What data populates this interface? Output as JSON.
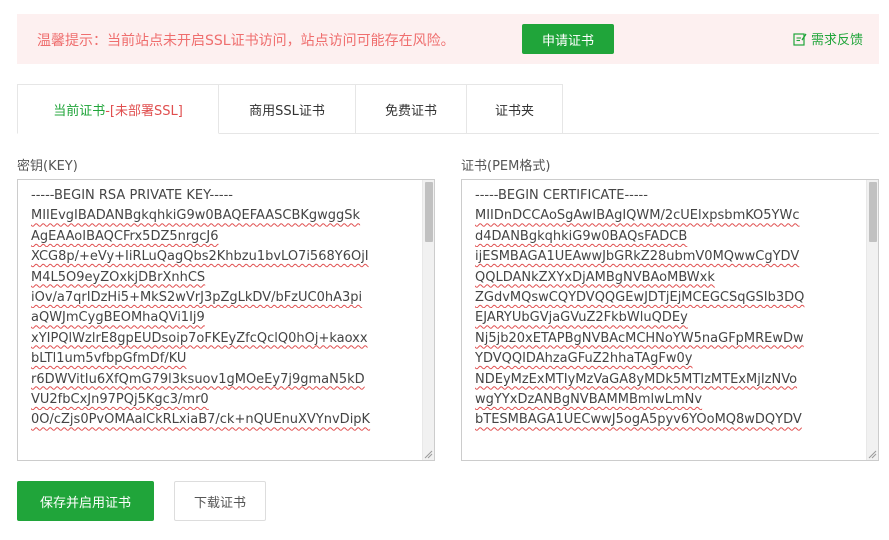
{
  "banner": {
    "warning_text": "温馨提示：当前站点未开启SSL证书访问，站点访问可能存在风险。",
    "apply_label": "申请证书",
    "feedback_label": "需求反馈",
    "feedback_icon": "edit-icon"
  },
  "tabs": [
    {
      "label": "当前证书",
      "status": " -[未部署SSL]",
      "active": true
    },
    {
      "label": "商用SSL证书",
      "active": false
    },
    {
      "label": "免费证书",
      "active": false
    },
    {
      "label": "证书夹",
      "active": false
    }
  ],
  "key_field": {
    "label": "密钥(KEY)",
    "lines": [
      "-----BEGIN RSA PRIVATE KEY-----",
      "MIIEvgIBADANBgkqhkiG9w0BAQEFAASCBKgwggSk",
      "AgEAAoIBAQCFrx5DZ5nrgcJ6",
      "XCG8p/+eVy+IiRLuQagQbs2Khbzu1bvLO7i568Y6OjI",
      "M4L5O9eyZOxkjDBrXnhCS",
      "iOv/a7qrIDzHi5+MkS2wVrJ3pZgLkDV/bFzUC0hA3pi",
      "aQWJmCygBEOMhaQVi1Ij9",
      "xYIPQlWzlrE8gpEUDsoip7oFKEyZfcQclQ0hOj+kaoxx",
      "bLTl1um5vfbpGfmDf/KU",
      "r6DWVitIu6XfQmG79l3ksuov1gMOeEy7j9gmaN5kD",
      "VU2fbCxJn97PQj5Kgc3/mr0",
      "0O/cZjs0PvOMAalCkRLxiaB7/ck+nQUEnuXVYnvDipK"
    ]
  },
  "cert_field": {
    "label": "证书(PEM格式)",
    "lines": [
      "-----BEGIN CERTIFICATE-----",
      "MIIDnDCCAoSgAwIBAgIQWM/2cUElxpsbmKO5YWc",
      "d4DANBgkqhkiG9w0BAQsFADCB",
      "ijESMBAGA1UEAwwJbGRkZ28ubmV0MQwwCgYDV",
      "QQLDANkZXYxDjAMBgNVBAoMBWxk",
      "ZGdvMQswCQYDVQQGEwJDTjEjMCEGCSqGSIb3DQ",
      "EJARYUbGVjaGVuZ2FkbWluQDEy",
      "Nj5jb20xETAPBgNVBAcMCHNoYW5naGFpMREwDw",
      "YDVQQIDAhzaGFuZ2hhaTAgFw0y",
      "NDEyMzExMTIyMzVaGA8yMDk5MTIzMTExMjIzNVo",
      "wgYYxDzANBgNVBAMMBmlwLmNv",
      "bTESMBAGA1UECwwJ5ogA5pyv6YOoMQ8wDQYDV"
    ]
  },
  "actions": {
    "save_label": "保存并启用证书",
    "download_label": "下载证书"
  },
  "colors": {
    "accent": "#20a53a",
    "warning_text": "#ef6e6e",
    "warning_bg": "#fdf0f0",
    "status_red": "#e04f4f"
  }
}
